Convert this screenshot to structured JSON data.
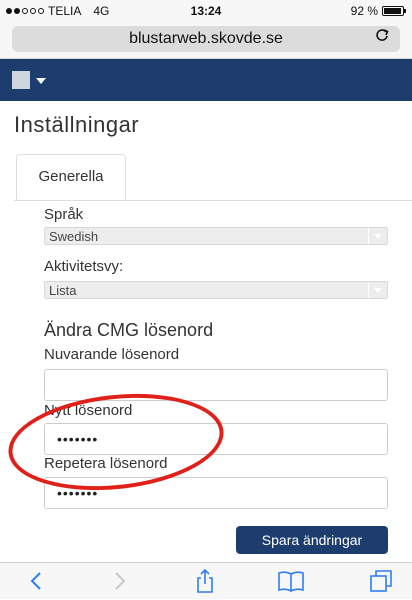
{
  "status_bar": {
    "carrier": "TELIA",
    "network": "4G",
    "time": "13:24",
    "battery": "92 %"
  },
  "browser": {
    "url": "blustarweb.skovde.se",
    "reload_icon": "reload-icon"
  },
  "page": {
    "title": "Inställningar",
    "tabs": [
      {
        "label": "Generella"
      }
    ],
    "language": {
      "label": "Språk",
      "value": "Swedish"
    },
    "activity_view": {
      "label": "Aktivitetsvy:",
      "value": "Lista"
    },
    "password_section": {
      "title": "Ändra CMG lösenord",
      "current": {
        "label": "Nuvarande lösenord",
        "value": ""
      },
      "new": {
        "label": "Nytt lösenord",
        "value": "•••••••"
      },
      "repeat": {
        "label": "Repetera lösenord",
        "value": "•••••••"
      }
    },
    "save_button": "Spara ändringar"
  },
  "colors": {
    "navbar": "#1c3d6e",
    "highlight": "#e0211a"
  }
}
